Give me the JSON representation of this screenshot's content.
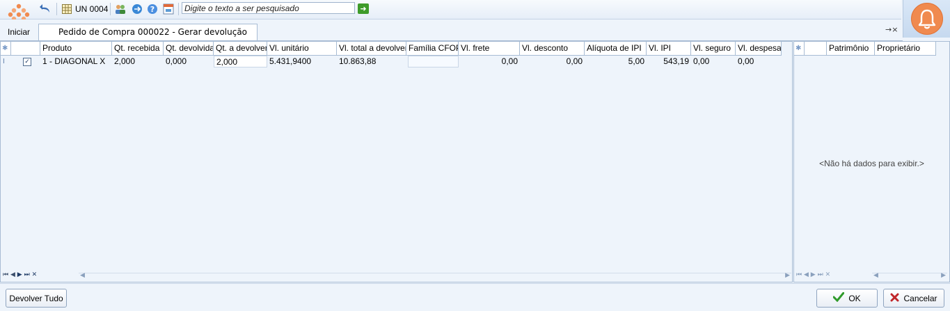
{
  "toolbar": {
    "unit_label": "UN 0004",
    "search_placeholder": "Digite o texto a ser pesquisado"
  },
  "tabs": {
    "home_label": "Iniciar",
    "active_tab_label": "Pedido de Compra 000022 - Gerar devolução",
    "controls": "→×"
  },
  "main_grid": {
    "columns": [
      "Produto",
      "Qt. recebida",
      "Qt. devolvida",
      "Qt. a devolver",
      "Vl. unitário",
      "Vl. total a devolver",
      "Família CFOP",
      "Vl. frete",
      "Vl. desconto",
      "Alíquota de IPI",
      "Vl. IPI",
      "Vl. seguro",
      "Vl. despesas"
    ],
    "rows": [
      {
        "checked": true,
        "produto": "1 - DIAGONAL X",
        "qt_recebida": "2,000",
        "qt_devolvida": "0,000",
        "qt_a_devolver": "2,000",
        "vl_unitario": "5.431,9400",
        "vl_total": "10.863,88",
        "familia_cfop": "",
        "vl_frete": "0,00",
        "vl_desconto": "0,00",
        "aliquota_ipi": "5,00",
        "vl_ipi": "543,19",
        "vl_seguro": "0,00",
        "vl_despesas": "0,00"
      }
    ]
  },
  "side_grid": {
    "columns": [
      "Patrimônio",
      "Proprietário"
    ],
    "empty_message": "<Não há dados para exibir.>"
  },
  "buttons": {
    "return_all": "Devolver Tudo",
    "ok": "OK",
    "cancel": "Cancelar"
  },
  "colors": {
    "accent_orange": "#f08a4f",
    "ok_green": "#2f9a2a",
    "cancel_red": "#c0262a",
    "grid_border": "#a8bcd4"
  }
}
